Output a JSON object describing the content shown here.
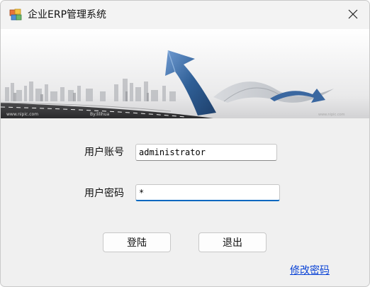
{
  "window": {
    "title": "企业ERP管理系统",
    "icon": "app-icon",
    "close_icon": "close-icon"
  },
  "banner": {
    "watermark_left": "www.nipic.com",
    "watermark_left_suffix": "By:lilihua",
    "watermark_right": "www.nipic.com"
  },
  "form": {
    "account_label": "用户账号",
    "account_value": "administrator",
    "password_label": "用户密码",
    "password_value": "*"
  },
  "buttons": {
    "login_label": "登陆",
    "exit_label": "退出"
  },
  "links": {
    "change_password_label": "修改密码"
  },
  "colors": {
    "accent": "#0067c0",
    "link": "#0a43d6",
    "arrow": "#2f5f96"
  }
}
